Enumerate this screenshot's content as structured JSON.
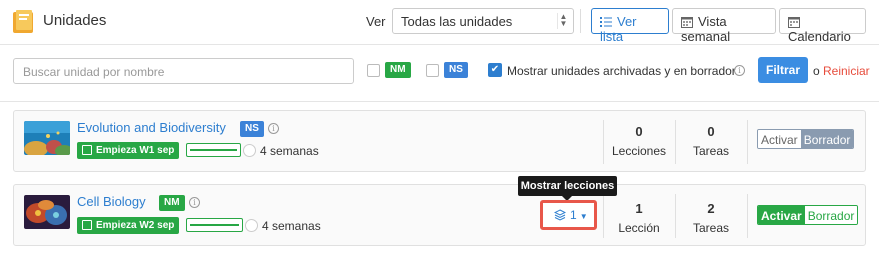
{
  "header": {
    "title": "Unidades",
    "view_label": "Ver",
    "view_select": "Todas las unidades",
    "views": [
      "Ver lista",
      "Vista semanal",
      "Calendario"
    ],
    "active_view": "Ver lista"
  },
  "filters": {
    "search_placeholder": "Buscar unidad por nombre",
    "level_nm": "NM",
    "level_ns": "NS",
    "nm_checked": false,
    "ns_checked": false,
    "archived_label": "Mostrar unidades archivadas y en borrador",
    "archived_checked": true,
    "filter_button": "Filtrar",
    "or_text": "o",
    "reset_link": "Reiniciar"
  },
  "units": [
    {
      "title": "Evolution and Biodiversity",
      "level": "NS",
      "starts": "Empieza W1 sep",
      "duration": "4 semanas",
      "lessons_count": "0",
      "lessons_label": "Lecciones",
      "tasks_count": "0",
      "tasks_label": "Tareas",
      "publish_active": "Activar",
      "publish_draft": "Borrador",
      "state": "draft"
    },
    {
      "title": "Cell Biology",
      "level": "NM",
      "starts": "Empieza W2 sep",
      "duration": "4 semanas",
      "lessons_count": "1",
      "lessons_label": "Lección",
      "tasks_count": "2",
      "tasks_label": "Tareas",
      "publish_active": "Activar",
      "publish_draft": "Borrador",
      "state": "active",
      "lessons_button_count": "1"
    }
  ],
  "tooltip": "Mostrar lecciones",
  "colors": {
    "primary": "#2d7ecf",
    "green": "#28a745",
    "highlight": "#e8574a",
    "reset": "#e74c3c"
  }
}
